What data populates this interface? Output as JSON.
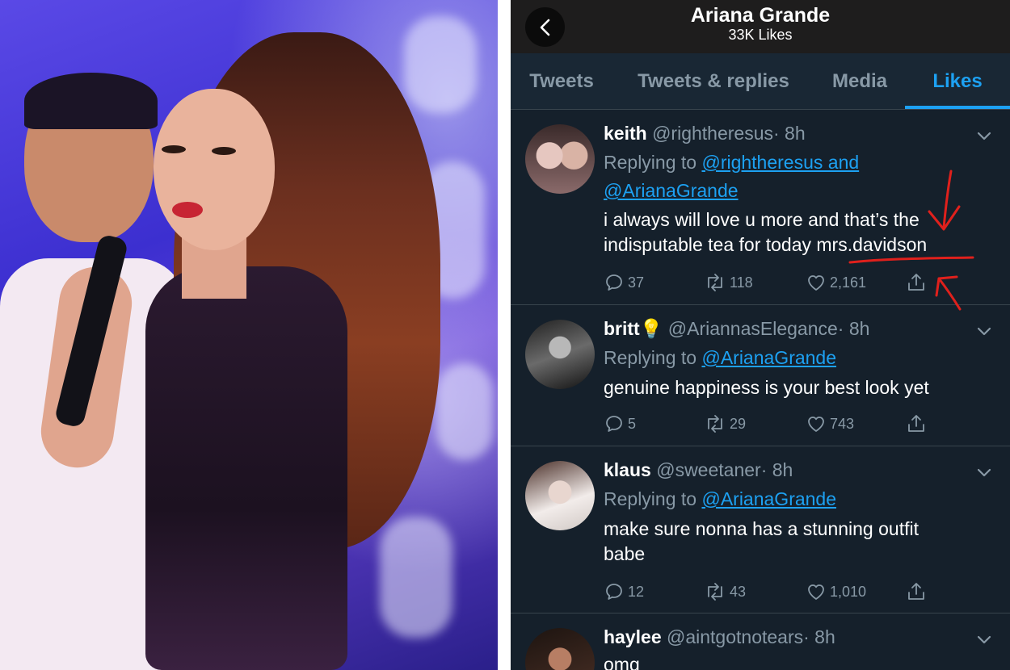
{
  "header": {
    "title": "Ariana Grande",
    "subtitle": "33K Likes"
  },
  "tabs": [
    {
      "label": "Tweets"
    },
    {
      "label": "Tweets & replies"
    },
    {
      "label": "Media"
    },
    {
      "label": "Likes",
      "active": true
    }
  ],
  "tweets": [
    {
      "name": "keith",
      "handle": "@rightheresus",
      "time": "· 8h",
      "reply_prefix": "Replying to",
      "mention_1": "@rightheresus and",
      "mention_2": "@ArianaGrande",
      "text_1": "i always will love u more and that’s the",
      "text_2": "indisputable tea for today mrs.davidson",
      "replies": "37",
      "retweets": "118",
      "likes": "2,161"
    },
    {
      "name": "britt",
      "emoji": "💡",
      "handle": "@AriannasElegance",
      "time": "· 8h",
      "reply_prefix": "Replying to",
      "mention_1": "@ArianaGrande",
      "text_1": "genuine happiness is your best look yet",
      "replies": "5",
      "retweets": "29",
      "likes": "743"
    },
    {
      "name": "klaus",
      "handle": "@sweetaner",
      "time": "· 8h",
      "reply_prefix": "Replying to",
      "mention_1": "@ArianaGrande",
      "text_1": "make sure nonna has a stunning outfit",
      "text_2": "babe",
      "replies": "12",
      "retweets": "43",
      "likes": "1,010"
    },
    {
      "name": "haylee",
      "handle": "@aintgotnotears",
      "time": "· 8h",
      "text_1": "omg"
    }
  ],
  "colors": {
    "background": "#15202b",
    "accent": "#1da1f2",
    "muted": "#8899a6",
    "annotation": "#e0201c"
  }
}
